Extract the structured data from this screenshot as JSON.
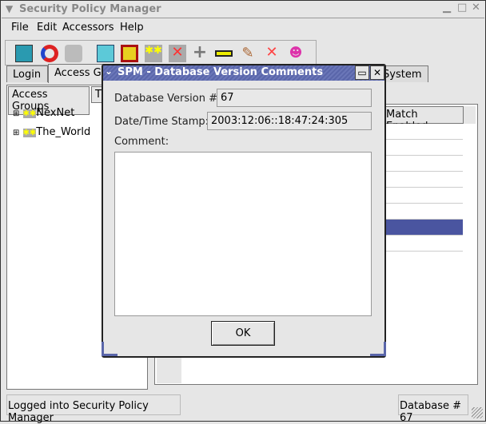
{
  "window": {
    "title": "Security Policy Manager"
  },
  "menu": [
    {
      "label": "File"
    },
    {
      "label": "Edit"
    },
    {
      "label": "Accessors"
    },
    {
      "label": "Help"
    }
  ],
  "toolbar": [
    "exit-icon",
    "refresh-icon",
    "handshake-icon",
    "open-box-icon",
    "package-icon",
    "group-icon",
    "delete-group-icon",
    "add-icon",
    "remove-icon",
    "edit-icon",
    "delete-user-icon",
    "user-icon"
  ],
  "tabs": [
    {
      "label": "Login"
    },
    {
      "label": "Access G"
    },
    {
      "label": "System"
    }
  ],
  "left_panel": {
    "headers": [
      "Access Groups",
      "T"
    ],
    "tree": [
      {
        "label": "NexNet"
      },
      {
        "label": "The_World"
      }
    ]
  },
  "right_panel": {
    "header": "Match Enabled",
    "selected_row": 6,
    "selected_color": "#4a55a0"
  },
  "status": {
    "left": "Logged into Security Policy Manager",
    "right": "Database # 67"
  },
  "dialog": {
    "title": "SPM - Database Version Comments",
    "version_label": "Database Version #:",
    "version_value": "67",
    "timestamp_label": "Date/Time Stamp:",
    "timestamp_value": "2003:12:06::18:47:24:305",
    "comment_label": "Comment:",
    "comment_value": "",
    "ok_label": "OK"
  }
}
